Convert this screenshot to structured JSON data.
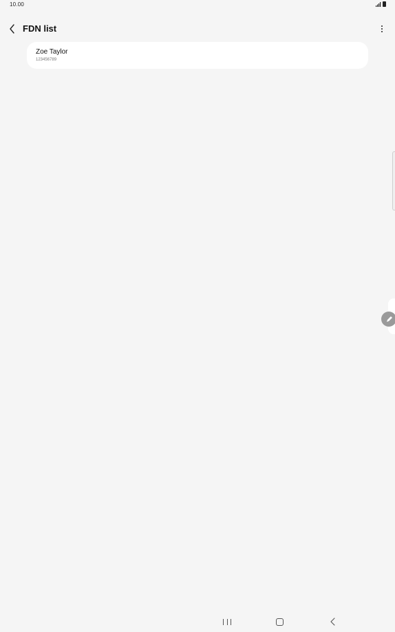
{
  "status_bar": {
    "time": "10.00",
    "icons": [
      "signal-icon",
      "battery-icon"
    ]
  },
  "app_bar": {
    "title": "FDN list",
    "back_icon": "chevron-left-icon",
    "more_icon": "more-vertical-icon"
  },
  "fdn_list": [
    {
      "name": "Zoe Taylor",
      "number": "123456789"
    }
  ],
  "navigation_bar": {
    "buttons": [
      "recents-icon",
      "home-icon",
      "back-icon"
    ]
  },
  "colors": {
    "background": "#f5f5f5",
    "card": "#ffffff",
    "primary_text": "#111111",
    "secondary_text": "#777777"
  }
}
